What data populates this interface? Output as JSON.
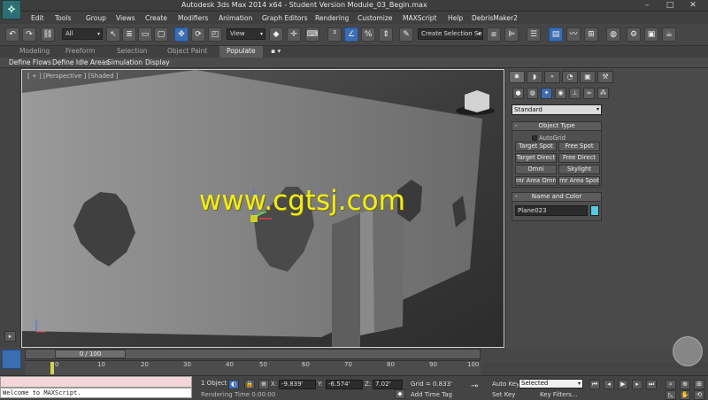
{
  "window": {
    "title": "Autodesk 3ds Max  2014 x64  - Student Version   Module_03_Begin.max",
    "minimize": "–",
    "maximize": "□",
    "close": "✕"
  },
  "menu": [
    "Edit",
    "Tools",
    "Group",
    "Views",
    "Create",
    "Modifiers",
    "Animation",
    "Graph Editors",
    "Rendering",
    "Customize",
    "MAXScript",
    "Help",
    "DebrisMaker2"
  ],
  "toolbar": {
    "selection_filter": "All",
    "reference_coord": "View",
    "named_selection_placeholder": "Create Selection Se"
  },
  "ribbon": {
    "tabs": [
      "Modeling",
      "Freeform",
      "Selection",
      "Object Paint",
      "Populate"
    ],
    "active_tab": "Populate",
    "toggle": "▪ ▾",
    "subtabs": [
      "Define Flows",
      "Define Idle Areas",
      "Simulation",
      "Display"
    ]
  },
  "viewport": {
    "label": "[ + ] [Perspective ] [Shaded ]",
    "watermark": "www.cgtsj.com"
  },
  "command_panel": {
    "category": "Standard",
    "object_type": {
      "header": "Object Type",
      "autogrid": "AutoGrid",
      "buttons": [
        "Target Spot",
        "Free Spot",
        "Target Direct",
        "Free Direct",
        "Omni",
        "Skylight",
        "mr Area Omni",
        "mr Area Spot"
      ]
    },
    "name_and_color": {
      "header": "Name and Color",
      "name": "Plane023",
      "color": "#57c9e0"
    }
  },
  "timeline": {
    "slider": "0 / 100",
    "ticks": [
      "0",
      "10",
      "20",
      "30",
      "40",
      "50",
      "60",
      "70",
      "80",
      "90",
      "100"
    ]
  },
  "status": {
    "maxscript_output": "Welcome to MAXScript.",
    "selection": "1 Object",
    "x_label": "X:",
    "x": "-9.839'",
    "y_label": "Y:",
    "y": "-6.574'",
    "z_label": "Z:",
    "z": "7.02'",
    "grid": "Grid = 0.833'",
    "rendering_time": "Rendering Time  0:00:00",
    "add_time_tag": "Add Time Tag",
    "auto_key": "Auto Key",
    "set_key": "Set Key",
    "key_mode": "Selected",
    "key_filters": "Key Filters..."
  },
  "colors": {
    "accent_blue": "#3b6db3",
    "watermark_yellow": "#f2ec1b",
    "maxscript_pink": "#f4d6d9"
  }
}
